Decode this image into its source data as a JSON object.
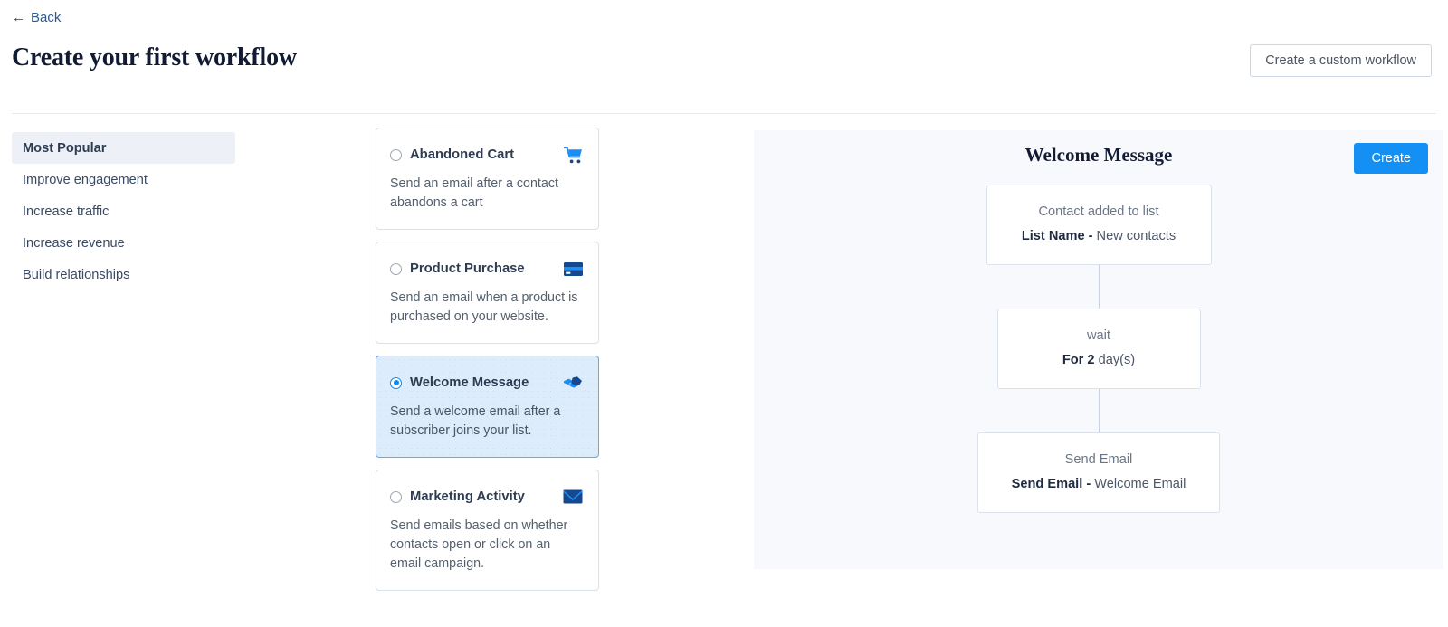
{
  "header": {
    "back_label": "Back",
    "back_icon": "arrow-left-icon",
    "title": "Create your first workflow",
    "custom_workflow_button": "Create a custom workflow"
  },
  "sidebar": {
    "items": [
      {
        "label": "Most Popular",
        "active": true
      },
      {
        "label": "Improve engagement",
        "active": false
      },
      {
        "label": "Increase traffic",
        "active": false
      },
      {
        "label": "Increase revenue",
        "active": false
      },
      {
        "label": "Build relationships",
        "active": false
      }
    ]
  },
  "cards": [
    {
      "title": "Abandoned Cart",
      "description": "Send an email after a contact abandons a cart",
      "icon": "shopping-cart-icon",
      "selected": false
    },
    {
      "title": "Product Purchase",
      "description": "Send an email when a product is purchased on your website.",
      "icon": "credit-card-icon",
      "selected": false
    },
    {
      "title": "Welcome Message",
      "description": "Send a welcome email after a subscriber joins your list.",
      "icon": "handshake-icon",
      "selected": true
    },
    {
      "title": "Marketing Activity",
      "description": "Send emails based on whether contacts open or click on an email campaign.",
      "icon": "envelope-icon",
      "selected": false
    }
  ],
  "preview": {
    "title": "Welcome Message",
    "create_button": "Create",
    "nodes": [
      {
        "kind": "Contact added to list",
        "detail_bold": "List Name -",
        "detail_rest": " New contacts"
      },
      {
        "kind": "wait",
        "detail_bold": "For 2",
        "detail_rest": " day(s)"
      },
      {
        "kind": "Send Email",
        "detail_bold": "Send Email -",
        "detail_rest": " Welcome Email"
      }
    ]
  },
  "colors": {
    "accent_blue": "#1490f5",
    "icon_dark_blue": "#15488f",
    "icon_light_blue": "#1b8ef5",
    "selected_card_bg": "#dcecfb",
    "selected_card_border": "#64a8f0",
    "panel_bg": "#f7f9fc",
    "title_color": "#121b33"
  }
}
